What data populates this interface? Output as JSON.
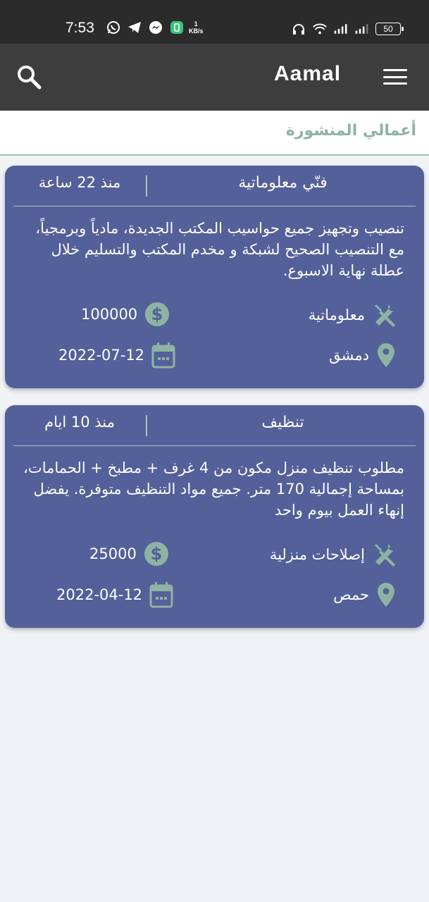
{
  "status_bar": {
    "time": "7:53",
    "speed_value": "1",
    "speed_unit": "KB/s",
    "battery": "50",
    "icons": [
      "whatsapp-icon",
      "telegram-icon",
      "messenger-icon",
      "app-icon",
      "headphones-icon",
      "wifi-icon",
      "signal-icon",
      "signal-icon-2",
      "battery-icon"
    ]
  },
  "app_bar": {
    "title": "Aamal",
    "search_icon": "search-icon",
    "menu_icon": "menu-icon"
  },
  "section": {
    "title": "أعمالي المنشورة"
  },
  "colors": {
    "card_bg": "#54609a",
    "accent_green": "#8fb3a2",
    "app_bar": "#3d3d3d",
    "page_bg": "#f0f2f6"
  },
  "jobs": [
    {
      "category": "فنّي معلوماتية",
      "posted": "منذ 22 ساعة",
      "description": "تنصيب وتجهيز جميع حواسيب المكتب الجديدة، مادياً وبرمجياً، مع التنصيب الصحيح لشبكة و مخدم المكتب والتسليم خلال عطلة نهاية الاسبوع.",
      "field": "معلوماتية",
      "price": "100000",
      "city": "دمشق",
      "date": "2022-07-12"
    },
    {
      "category": "تنظيف",
      "posted": "منذ 10 ايام",
      "description": "مطلوب تنظيف منزل مكون من 4 غرف + مطبخ + الحمامات، بمساحة إجمالية 170 متر. جميع مواد التنظيف متوفرة. يفضل إنهاء العمل بيوم واحد",
      "field": "إصلاحات منزلية",
      "price": "25000",
      "city": "حمص",
      "date": "2022-04-12"
    }
  ]
}
